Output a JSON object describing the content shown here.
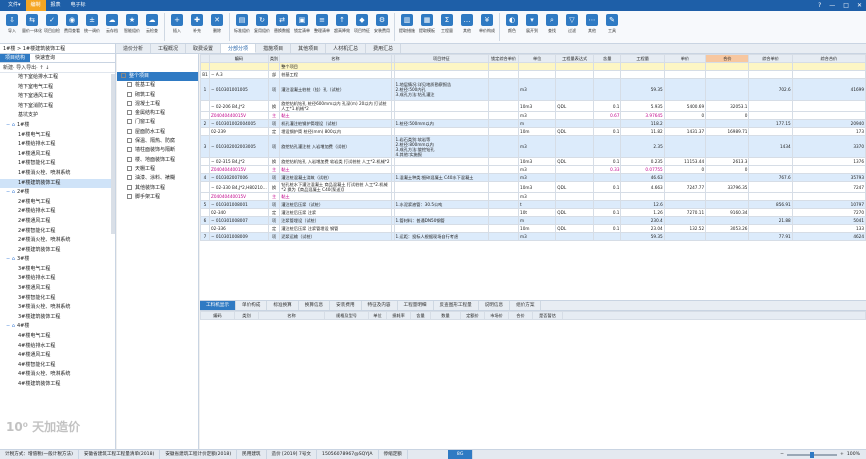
{
  "menu": [
    "文件▾",
    "编制",
    "报表",
    "电子标"
  ],
  "menu_active": 1,
  "window_controls": [
    "?",
    "—",
    "□",
    "✕"
  ],
  "toolbar": [
    {
      "label": "导入",
      "icon": "import-icon"
    },
    {
      "label": "量价一体化",
      "icon": "merge-icon"
    },
    {
      "label": "项目自检",
      "icon": "check-icon"
    },
    {
      "label": "费用查看",
      "icon": "view-icon"
    },
    {
      "label": "统一调价",
      "icon": "adjust-icon"
    },
    {
      "label": "云存档",
      "icon": "cloud-save-icon"
    },
    {
      "label": "智能组价",
      "icon": "smart-icon"
    },
    {
      "label": "云检查",
      "icon": "cloud-check-icon"
    },
    {
      "label": "插入",
      "icon": "insert-icon"
    },
    {
      "label": "补充",
      "icon": "supplement-icon"
    },
    {
      "label": "删除",
      "icon": "delete-icon"
    },
    {
      "label": "标准组价",
      "icon": "standard-icon"
    },
    {
      "label": "复用组价",
      "icon": "reuse-icon"
    },
    {
      "label": "替换数据",
      "icon": "replace-icon"
    },
    {
      "label": "锁定清单",
      "icon": "lock-icon"
    },
    {
      "label": "整理清单",
      "icon": "sort-icon"
    },
    {
      "label": "超高降效",
      "icon": "height-icon"
    },
    {
      "label": "项目特征",
      "icon": "feature-icon"
    },
    {
      "label": "安装费用",
      "icon": "install-icon"
    },
    {
      "label": "提取措施",
      "icon": "extract-icon"
    },
    {
      "label": "提取模板",
      "icon": "template-icon"
    },
    {
      "label": "工程量",
      "icon": "quantity-icon"
    },
    {
      "label": "其他",
      "icon": "other-icon"
    },
    {
      "label": "单价构成",
      "icon": "unit-price-icon"
    },
    {
      "label": "颜色",
      "icon": "color-icon"
    },
    {
      "label": "展开到",
      "icon": "expand-icon"
    },
    {
      "label": "查找",
      "icon": "find-icon"
    },
    {
      "label": "过滤",
      "icon": "filter-icon"
    },
    {
      "label": "其他",
      "icon": "more-icon"
    },
    {
      "label": "工具",
      "icon": "tools-icon"
    }
  ],
  "breadcrumb": "1#楼 > 1#楼建筑装饰工程",
  "view_tabs": [
    "造价分析",
    "工程概况",
    "取费设置",
    "分部分项",
    "措施项目",
    "其他项目",
    "人材机汇总",
    "费用汇总"
  ],
  "view_tab_active": 3,
  "left_tabs": [
    "项目结构",
    "快速查询"
  ],
  "left_tab_active": 0,
  "left_tools": "新建·  导入导出·  ↑  ↓",
  "tree": [
    {
      "label": "地下室给排水工程",
      "indent": 2
    },
    {
      "label": "地下室电气工程",
      "indent": 2
    },
    {
      "label": "地下室通风工程",
      "indent": 2
    },
    {
      "label": "地下室消防工程",
      "indent": 2
    },
    {
      "label": "基坑支护",
      "indent": 2
    },
    {
      "label": "1#楼",
      "indent": 1,
      "folder": true
    },
    {
      "label": "1#楼电气工程",
      "indent": 2
    },
    {
      "label": "1#楼给排水工程",
      "indent": 2
    },
    {
      "label": "1#楼通风工程",
      "indent": 2
    },
    {
      "label": "1#楼智能化工程",
      "indent": 2
    },
    {
      "label": "1#楼消火栓、喷淋系统",
      "indent": 2
    },
    {
      "label": "1#楼建筑装饰工程",
      "indent": 2,
      "selected": true
    },
    {
      "label": "2#楼",
      "indent": 1,
      "folder": true
    },
    {
      "label": "2#楼电气工程",
      "indent": 2
    },
    {
      "label": "2#楼给排水工程",
      "indent": 2
    },
    {
      "label": "2#楼通风工程",
      "indent": 2
    },
    {
      "label": "2#楼智能化工程",
      "indent": 2
    },
    {
      "label": "2#楼消火栓、喷淋系统",
      "indent": 2
    },
    {
      "label": "2#楼建筑装饰工程",
      "indent": 2
    },
    {
      "label": "3#楼",
      "indent": 1,
      "folder": true
    },
    {
      "label": "3#楼电气工程",
      "indent": 2
    },
    {
      "label": "3#楼给排水工程",
      "indent": 2
    },
    {
      "label": "3#楼通风工程",
      "indent": 2
    },
    {
      "label": "3#楼智能化工程",
      "indent": 2
    },
    {
      "label": "3#楼消火栓、喷淋系统",
      "indent": 2
    },
    {
      "label": "3#楼建筑装饰工程",
      "indent": 2
    },
    {
      "label": "4#楼",
      "indent": 1,
      "folder": true
    },
    {
      "label": "4#楼电气工程",
      "indent": 2
    },
    {
      "label": "4#楼给排水工程",
      "indent": 2
    },
    {
      "label": "4#楼通风工程",
      "indent": 2
    },
    {
      "label": "4#楼智能化工程",
      "indent": 2
    },
    {
      "label": "4#楼消火栓、喷淋系统",
      "indent": 2
    },
    {
      "label": "4#楼建筑装饰工程",
      "indent": 2
    }
  ],
  "mid_list": [
    "整个项目",
    "桩基工程",
    "砌筑工程",
    "混凝土工程",
    "金属结构工程",
    "门窗工程",
    "屋面防水工程",
    "保温、隔热、防腐",
    "墙柱面装饰与隔断",
    "楼、地面装饰工程",
    "天棚工程",
    "油漆、涂料、裱糊",
    "其他装饰工程",
    "脚手架工程"
  ],
  "mid_selected": 0,
  "grid_headers": [
    "",
    "编码",
    "类别",
    "名称",
    "",
    "项目特征",
    "锁定综合单价",
    "单位",
    "工程量表达式",
    "含量",
    "工程量",
    "单价",
    "合价",
    "综合单价",
    "综合合价"
  ],
  "grid_header_highlight": 12,
  "grid_rows": [
    {
      "type": "sum",
      "cells": [
        "",
        "",
        "",
        "整个项目",
        "",
        "",
        "",
        "",
        "",
        "",
        "",
        "",
        "",
        "",
        ""
      ]
    },
    {
      "type": "group",
      "cells": [
        "B1",
        "− A.3",
        "部",
        "桩基工程",
        "",
        "",
        "",
        "",
        "",
        "",
        "",
        "",
        "",
        "",
        ""
      ]
    },
    {
      "type": "qd",
      "cells": [
        "1",
        "− 010301001005",
        "项",
        "灌注混凝土桩桩（挂）孔（试桩）",
        "",
        "1.地层情况:详见地质勘察报告\n2.桩径:500内孔\n3.成孔方法:钻孔灌注",
        "",
        "m3",
        "",
        "",
        "59.35",
        "",
        "",
        "702.6",
        "41699"
      ]
    },
    {
      "type": "de",
      "cells": [
        "",
        "− 02-206 B4,J*2",
        "换",
        "旋挖钻机钻孔 桩径600mm以内 孔深(m) 20以内 打试桩 人工*1.机械*2",
        "",
        "",
        "",
        "10m3",
        "QDL",
        "0.1",
        "5.935",
        "5400.69",
        "32053.1",
        "",
        ""
      ]
    },
    {
      "type": "sub",
      "cells": [
        "",
        "Z04040440015V",
        "主",
        "黏土",
        "",
        "",
        "",
        "m3",
        "",
        "0.67",
        "3.97645",
        "0",
        "0",
        "",
        ""
      ]
    },
    {
      "type": "qd",
      "cells": [
        "2",
        "− 010301002004005",
        "项",
        "机孔灌注桩钢护筒埋设（试桩）",
        "",
        "1.桩径:500mm以内",
        "",
        "m",
        "",
        "",
        "118.2",
        "",
        "",
        "177.15",
        "20940"
      ]
    },
    {
      "type": "de",
      "cells": [
        "",
        "02-239",
        "定",
        "埋设钢护筒 桩径(mm) 800以内",
        "",
        "",
        "",
        "10m",
        "QDL",
        "0.1",
        "11.82",
        "1431.37",
        "16989.71",
        "",
        "173"
      ]
    },
    {
      "type": "qd",
      "cells": [
        "3",
        "− 010302002003005",
        "项",
        "旋挖钻孔灌注桩 入岩增加费（试桩）",
        "",
        "1.岩石类别:软岩等\n2.桩径:800mm以内\n3.成孔方法:旋挖钻孔\n4.其他:实施报",
        "",
        "m3",
        "",
        "",
        "2.35",
        "",
        "",
        "1434",
        "3370"
      ]
    },
    {
      "type": "de",
      "cells": [
        "",
        "− 02-315 B4,J*2",
        "换",
        "旋挖钻机钻孔 入岩增加费 软岩类 打试桩桩 人工*2.机械*2",
        "",
        "",
        "",
        "10m3",
        "QDL",
        "0.1",
        "0.235",
        "11153.44",
        "2613.3",
        "",
        "1376"
      ]
    },
    {
      "type": "sub",
      "cells": [
        "",
        "Z04040440015V",
        "主",
        "黏土",
        "",
        "",
        "",
        "m3",
        "",
        "0.33",
        "0.07755",
        "0",
        "0",
        "",
        ""
      ]
    },
    {
      "type": "qd",
      "cells": [
        "4",
        "− 010302007006",
        "项",
        "灌注桩混凝土浇筑（试桩）",
        "",
        "1.混凝土种类:细碎混凝土 C40水下混凝土",
        "",
        "m3",
        "",
        "",
        "46.63",
        "",
        "",
        "767.6",
        "35793"
      ]
    },
    {
      "type": "de",
      "cells": [
        "",
        "− 02-330 B4,J*2,H80210…",
        "换",
        "钻孔桩水下灌注混凝土 商品混凝土 打试桩桩 人工*2.机械*2 换为【商品混凝土 C40(泵送)】",
        "",
        "",
        "",
        "10m3",
        "QDL",
        "0.1",
        "4.663",
        "7247.77",
        "33796.35",
        "",
        "7247"
      ]
    },
    {
      "type": "sub",
      "cells": [
        "",
        "Z04040440015V",
        "主",
        "黏土",
        "",
        "",
        "",
        "m3",
        "",
        "",
        "",
        "",
        "",
        "",
        ""
      ]
    },
    {
      "type": "qd",
      "cells": [
        "5",
        "− 010301008001",
        "项",
        "灌注桩后压浆（试桩）",
        "",
        "1.水泥浆液管：30.5公吨",
        "",
        "t",
        "",
        "",
        "12.6",
        "",
        "",
        "856.91",
        "10797"
      ]
    },
    {
      "type": "de",
      "cells": [
        "",
        "02-340",
        "定",
        "灌注桩后压浆 注浆",
        "",
        "",
        "",
        "10t",
        "QDL",
        "0.1",
        "1.26",
        "7270.11",
        "9160.34",
        "",
        "7270"
      ]
    },
    {
      "type": "qd",
      "cells": [
        "6",
        "− 010301008007",
        "项",
        "注浆管埋设（试桩）",
        "",
        "1.管材料：普通DN50钢管",
        "",
        "m",
        "",
        "",
        "230.4",
        "",
        "",
        "21.88",
        "5041"
      ]
    },
    {
      "type": "de",
      "cells": [
        "",
        "02-336",
        "定",
        "灌注桩后压浆 注浆管埋设 钢管",
        "",
        "",
        "",
        "10m",
        "QDL",
        "0.1",
        "23.04",
        "132.52",
        "3053.26",
        "",
        "133"
      ]
    },
    {
      "type": "qd",
      "cells": [
        "7",
        "− 010301008009",
        "项",
        "泥浆运输（试桩）",
        "",
        "1.运距：投标人根据现场自行考虑",
        "",
        "m3",
        "",
        "",
        "59.35",
        "",
        "",
        "77.91",
        "4624"
      ]
    }
  ],
  "bottom_tabs": [
    "工料机显示",
    "单价构成",
    "标准换算",
    "换算信息",
    "安装费用",
    "特征及内容",
    "工程量明细",
    "反查图形工程量",
    "说明信息",
    "组价方案"
  ],
  "bottom_tab_active": 0,
  "detail_headers": [
    "编码",
    "类别",
    "名称",
    "规格及型号",
    "单位",
    "损耗率",
    "含量",
    "数量",
    "定额价",
    "市场价",
    "合价",
    "是否暂估"
  ],
  "status": [
    {
      "label": "计税方式：增值税(一般计税方法)"
    },
    {
      "label": "安徽省建筑工程工程量清单(2018)"
    },
    {
      "label": "安徽省建筑工程计价定额(2018)"
    },
    {
      "label": "民用建筑"
    },
    {
      "label": "造价 [2019] 7号文"
    },
    {
      "label": "15056078967@SQYJA"
    },
    {
      "label": "停缩定额"
    }
  ],
  "status_badge": "8G",
  "zoom": {
    "percent": 100,
    "label": "100%"
  },
  "watermark": "10⁰ 天加造价",
  "colors": {
    "accent": "#2f7ac3",
    "menu": "#1e5fa8",
    "highlight": "#f7c7a0",
    "sum_row": "#fdf6c4",
    "qd_row": "#dcebfb"
  }
}
